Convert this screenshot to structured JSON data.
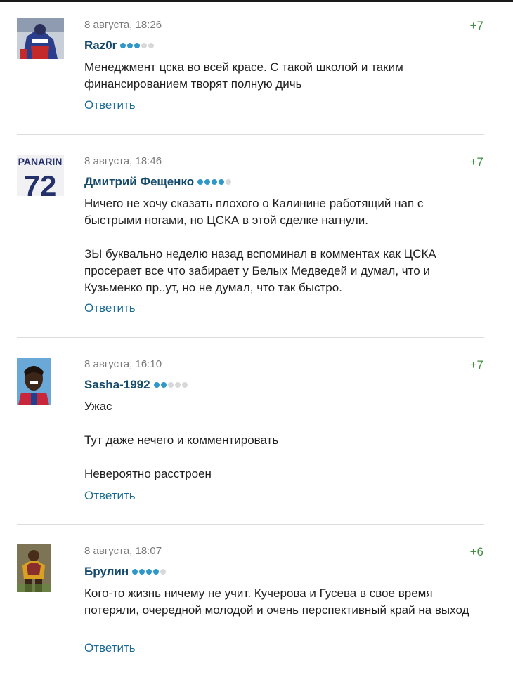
{
  "comments": [
    {
      "date": "8 августа, 18:26",
      "author": "Raz0r",
      "level": 3,
      "rating": "+7",
      "paragraphs": [
        "Менеджмент цска во всей красе. С такой школой и таким финансированием творят полную дичь"
      ],
      "reply": "Ответить",
      "avatar_icon": "hockey-player-photo"
    },
    {
      "date": "8 августа, 18:46",
      "author": "Дмитрий Фещенко",
      "level": 4,
      "rating": "+7",
      "paragraphs": [
        "Ничего не хочу сказать плохого о Калинине работящий нап с быстрыми ногами, но ЦСКА в этой сделке нагнули.",
        "ЗЫ буквально неделю назад вспоминал в комментах как ЦСКА просерает все что забирает у Белых Медведей и думал, что и Кузьменко пр..ут, но не думал, что так быстро."
      ],
      "reply": "Ответить",
      "avatar_icon": "jersey-photo",
      "jersey_name": "PANARIN",
      "jersey_number": "72"
    },
    {
      "date": "8 августа, 16:10",
      "author": "Sasha-1992",
      "level": 2,
      "rating": "+7",
      "paragraphs": [
        "Ужас",
        "Тут даже нечего и комментировать",
        "Невероятно расстроен"
      ],
      "reply": "Ответить",
      "avatar_icon": "person-photo"
    },
    {
      "date": "8 августа, 18:07",
      "author": "Брулин",
      "level": 4,
      "rating": "+6",
      "paragraphs": [
        "Кого-то жизнь ничему не учит. Кучерова и Гусева в свое время потеряли, очередной молодой и очень перспективный край на выход"
      ],
      "reply": "Ответить",
      "avatar_icon": "football-player-photo"
    }
  ],
  "colors": {
    "author": "#144a6b",
    "reply": "#1b6a92",
    "rating": "#3f8f3f",
    "dot_on": "#2f97c9",
    "dot_off": "#d8d8d8"
  }
}
